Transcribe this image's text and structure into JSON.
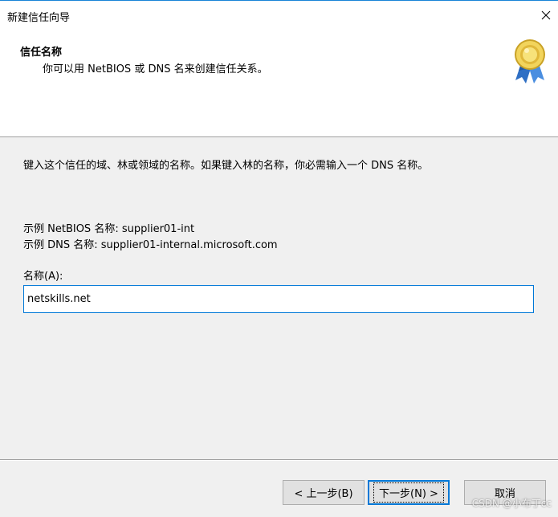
{
  "window": {
    "title": "新建信任向导"
  },
  "header": {
    "title": "信任名称",
    "subtitle": "你可以用 NetBIOS 或 DNS 名来创建信任关系。"
  },
  "content": {
    "description": "键入这个信任的域、林或领域的名称。如果键入林的名称，你必需输入一个 DNS 名称。",
    "example_netbios": "示例 NetBIOS 名称: supplier01-int",
    "example_dns": "示例 DNS 名称: supplier01-internal.microsoft.com",
    "name_label": "名称(A):",
    "name_value": "netskills.net"
  },
  "buttons": {
    "back": "< 上一步(B)",
    "next": "下一步(N) >",
    "cancel": "取消"
  },
  "watermark": "CSDN @小布丁cc",
  "colors": {
    "accent": "#0078d7",
    "dialog_bg": "#f0f0f0",
    "button_bg": "#e1e1e1"
  },
  "icons": {
    "close": "close-icon",
    "wizard": "award-ribbon-icon"
  }
}
